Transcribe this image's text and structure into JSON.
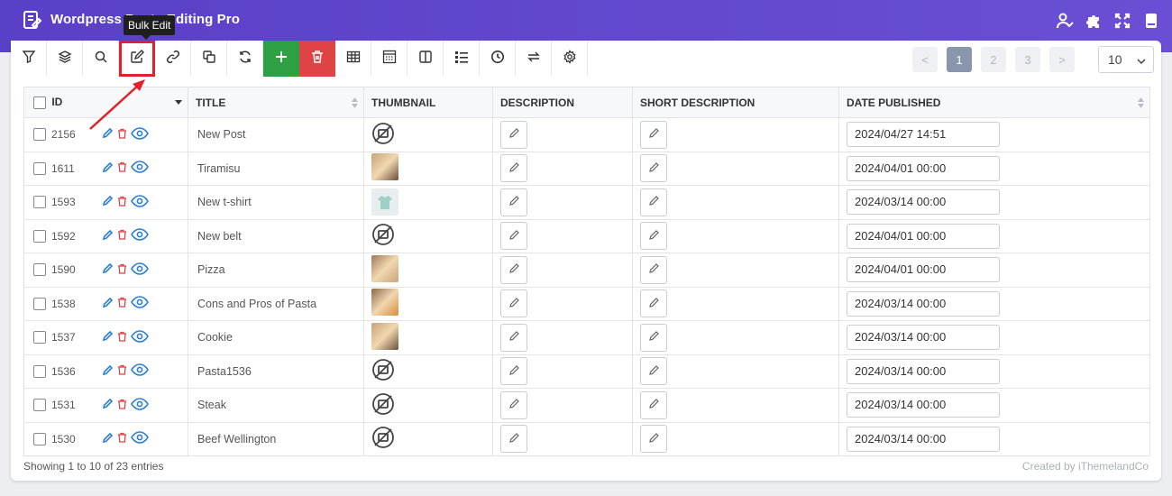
{
  "app": {
    "title": "Wordpress Posts Editing Pro"
  },
  "toolbar": {
    "tooltip": "Bulk Edit",
    "buttons": [
      "filter-icon",
      "layers-icon",
      "search-icon",
      "bulk-edit-icon",
      "link-icon",
      "duplicate-icon",
      "refresh-icon",
      "add-icon",
      "delete-icon",
      "table-icon",
      "column-profile-icon",
      "split-columns-icon",
      "list-icon",
      "history-icon",
      "swap-icon",
      "settings-icon"
    ]
  },
  "pagination": {
    "prev": "<",
    "pages": [
      "1",
      "2",
      "3"
    ],
    "next": ">",
    "active": "1",
    "per_page": "10"
  },
  "table": {
    "headers": {
      "id": "ID",
      "title": "TITLE",
      "thumbnail": "THUMBNAIL",
      "description": "DESCRIPTION",
      "short_description": "SHORT DESCRIPTION",
      "date_published": "DATE PUBLISHED"
    },
    "rows": [
      {
        "id": "2156",
        "title": "New Post",
        "thumb": "none",
        "date": "2024/04/27 14:51"
      },
      {
        "id": "1611",
        "title": "Tiramisu",
        "thumb": "photo",
        "date": "2024/04/01 00:00"
      },
      {
        "id": "1593",
        "title": "New t-shirt",
        "thumb": "shirt",
        "date": "2024/03/14 00:00"
      },
      {
        "id": "1592",
        "title": "New belt",
        "thumb": "none",
        "date": "2024/04/01 00:00"
      },
      {
        "id": "1590",
        "title": "Pizza",
        "thumb": "photo",
        "date": "2024/04/01 00:00"
      },
      {
        "id": "1538",
        "title": "Cons and Pros of Pasta",
        "thumb": "photo",
        "date": "2024/03/14 00:00"
      },
      {
        "id": "1537",
        "title": "Cookie",
        "thumb": "photo",
        "date": "2024/03/14 00:00"
      },
      {
        "id": "1536",
        "title": "Pasta1536",
        "thumb": "none",
        "date": "2024/03/14 00:00"
      },
      {
        "id": "1531",
        "title": "Steak",
        "thumb": "none",
        "date": "2024/03/14 00:00"
      },
      {
        "id": "1530",
        "title": "Beef Wellington",
        "thumb": "none",
        "date": "2024/03/14 00:00"
      }
    ]
  },
  "footer": {
    "entries": "Showing 1 to 10 of 23 entries",
    "credit": "Created by iThemelandCo"
  },
  "colors": {
    "header": "#5a40c6",
    "add": "#2ea043",
    "delete": "#e04346",
    "highlight": "#e0232a",
    "row_icon": "#2a7fd4"
  }
}
